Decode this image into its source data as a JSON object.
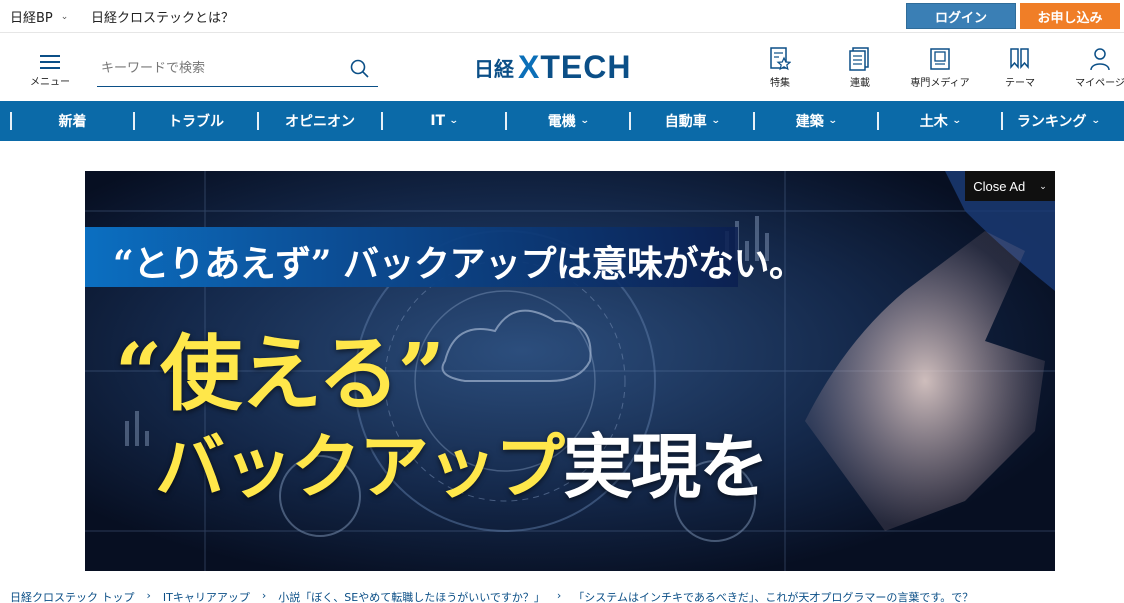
{
  "topbar": {
    "corp_label": "日経BP",
    "about_label": "日経クロステックとは？",
    "login_label": "ログイン",
    "apply_label": "お申し込み",
    "login_color": "#3a7fb5",
    "apply_color": "#f07e27"
  },
  "header": {
    "menu_label": "メニュー",
    "search_placeholder": "キーワードで検索",
    "logo_nikkei": "日経",
    "logo_x": "X",
    "logo_tech": "TECH",
    "nav_icons": [
      {
        "label": "特集",
        "icon": "star-doc-icon"
      },
      {
        "label": "連載",
        "icon": "document-icon"
      },
      {
        "label": "専門メディア",
        "icon": "magazine-icon"
      },
      {
        "label": "テーマ",
        "icon": "bookmarks-icon"
      },
      {
        "label": "マイページ",
        "icon": "user-icon"
      }
    ]
  },
  "categories": [
    {
      "label": "新着",
      "dropdown": false
    },
    {
      "label": "トラブル",
      "dropdown": false
    },
    {
      "label": "オピニオン",
      "dropdown": false
    },
    {
      "label": "IT",
      "dropdown": true
    },
    {
      "label": "電機",
      "dropdown": true
    },
    {
      "label": "自動車",
      "dropdown": true
    },
    {
      "label": "建築",
      "dropdown": true
    },
    {
      "label": "土木",
      "dropdown": true
    },
    {
      "label": "ランキング",
      "dropdown": true
    }
  ],
  "ad": {
    "close_label": "Close Ad",
    "headline_1": "“とりあえず” バックアップは意味がない。",
    "headline_2": "“使える”",
    "headline_3a": "バックアップ",
    "headline_3b": "実現を"
  },
  "breadcrumb": [
    "日経クロステック トップ",
    "ITキャリアアップ",
    "小説「ぼく、SEやめて転職したほうがいいですか？」",
    "「システムはインチキであるべきだ」、これが天才プログラマーの言葉です。で？"
  ],
  "colors": {
    "brand": "#0b4f87",
    "nav_bg": "#0b6aa8"
  }
}
